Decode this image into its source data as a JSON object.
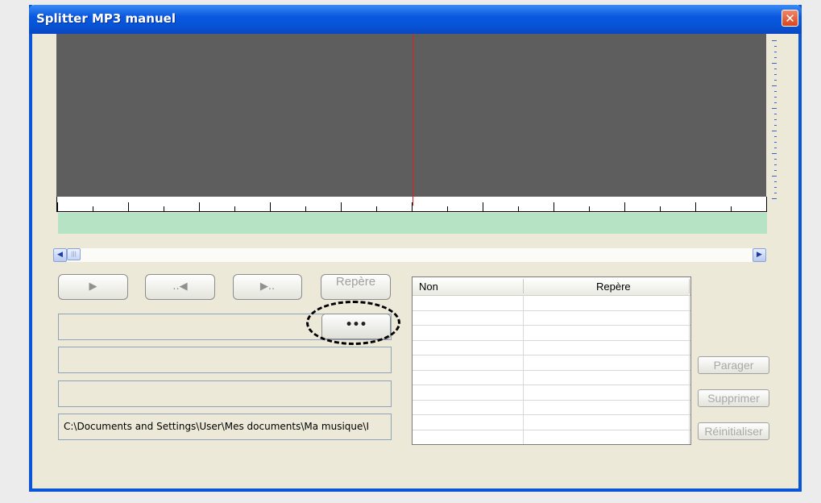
{
  "window": {
    "title": "Splitter MP3 manuel",
    "close_glyph": "✕"
  },
  "icons": {
    "play": "▶",
    "back": "..◀",
    "forward": "▶..",
    "scroll_left": "◀",
    "scroll_right": "▶",
    "thumb": "|||"
  },
  "controls": {
    "marker_label": "Repère",
    "browse_label": "•••"
  },
  "fields": {
    "field1_value": "",
    "field2_value": "",
    "field3_value": "",
    "path_value": "C:\\Documents and Settings\\User\\Mes documents\\Ma musique\\I"
  },
  "table": {
    "columns": [
      "Non",
      "Repère"
    ],
    "rows": [
      [
        "",
        ""
      ],
      [
        "",
        ""
      ],
      [
        "",
        ""
      ],
      [
        "",
        ""
      ],
      [
        "",
        ""
      ],
      [
        "",
        ""
      ],
      [
        "",
        ""
      ],
      [
        "",
        ""
      ],
      [
        "",
        ""
      ],
      [
        "",
        ""
      ]
    ]
  },
  "side_buttons": {
    "split": "Parager",
    "delete": "Supprimer",
    "reset": "Réinitialiser"
  },
  "colors": {
    "title_bar": "#0654d6",
    "waveform": "#5e5e5e",
    "playhead": "#e02020",
    "selection": "#b5e3c3",
    "highlight_outline": "#000000"
  }
}
